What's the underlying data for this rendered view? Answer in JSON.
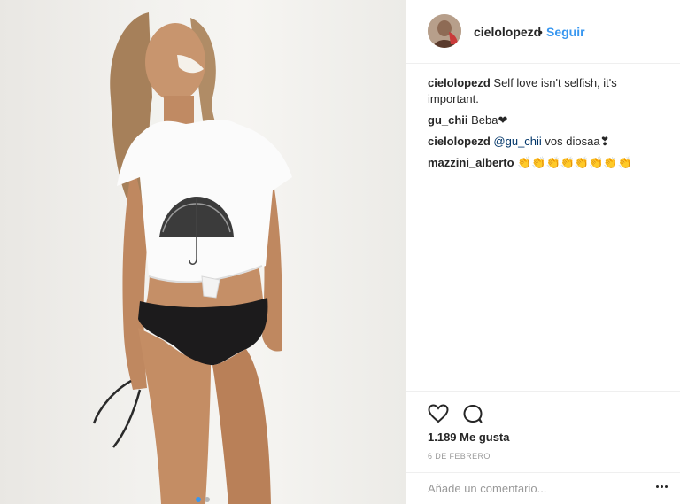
{
  "post": {
    "author": "cielolopezd",
    "separator": "•",
    "follow_label": "Seguir",
    "comments": [
      {
        "user": "cielolopezd",
        "text": " Self love isn't selfish, it's important."
      },
      {
        "user": "gu_chii",
        "text": " Beba❤"
      },
      {
        "user": "cielolopezd",
        "mention": " @gu_chii",
        "text": " vos diosaa❣"
      },
      {
        "user": "mazzini_alberto",
        "text": " 👏👏👏👏👏👏👏👏"
      }
    ],
    "likes": "1.189 Me gusta",
    "date": "6 DE FEBRERO",
    "comment_placeholder": "Añade un comentario...",
    "carousel": {
      "count": 2,
      "active_index": 0
    }
  },
  "colors": {
    "accent": "#3897f0",
    "text": "#262626",
    "muted": "#999999",
    "divider": "#efefef"
  },
  "icons": {
    "like": "heart-outline-icon",
    "comment": "speech-bubble-icon",
    "more": "more-dots-icon"
  }
}
